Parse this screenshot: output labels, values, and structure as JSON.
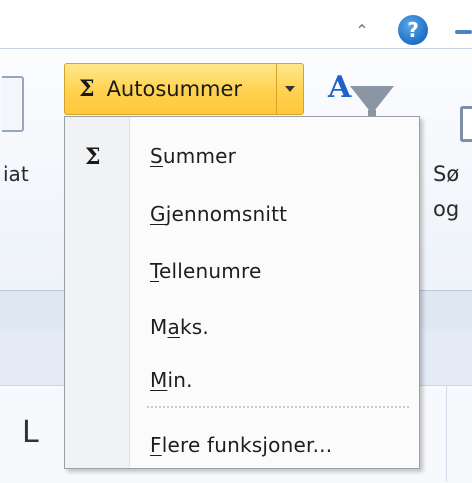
{
  "ribbon": {
    "autosum": {
      "label": "Autosummer",
      "icon": "sigma-icon",
      "symbol": "Σ"
    },
    "sort_filter_icon_letter": "A",
    "left_group_label": "iat",
    "right_group_label_line1": "Sø",
    "right_group_label_line2": "og",
    "column_letter": "L",
    "help_symbol": "?",
    "accent_color": "#ffd14e"
  },
  "menu": {
    "items": [
      {
        "label": "Summer",
        "accel": "S",
        "rest": "ummer",
        "icon": "sigma-icon",
        "symbol": "Σ"
      },
      {
        "label": "Gjennomsnitt",
        "accel": "G",
        "rest": "jennomsnitt"
      },
      {
        "label": "Tellenumre",
        "accel": "T",
        "rest": "ellenumre"
      },
      {
        "label": "Maks.",
        "pre": "M",
        "accel": "a",
        "rest": "ks."
      },
      {
        "label": "Min.",
        "accel": "M",
        "rest": "in."
      },
      {
        "label": "Flere funksjoner...",
        "accel": "F",
        "rest": "lere funksjoner..."
      }
    ]
  }
}
